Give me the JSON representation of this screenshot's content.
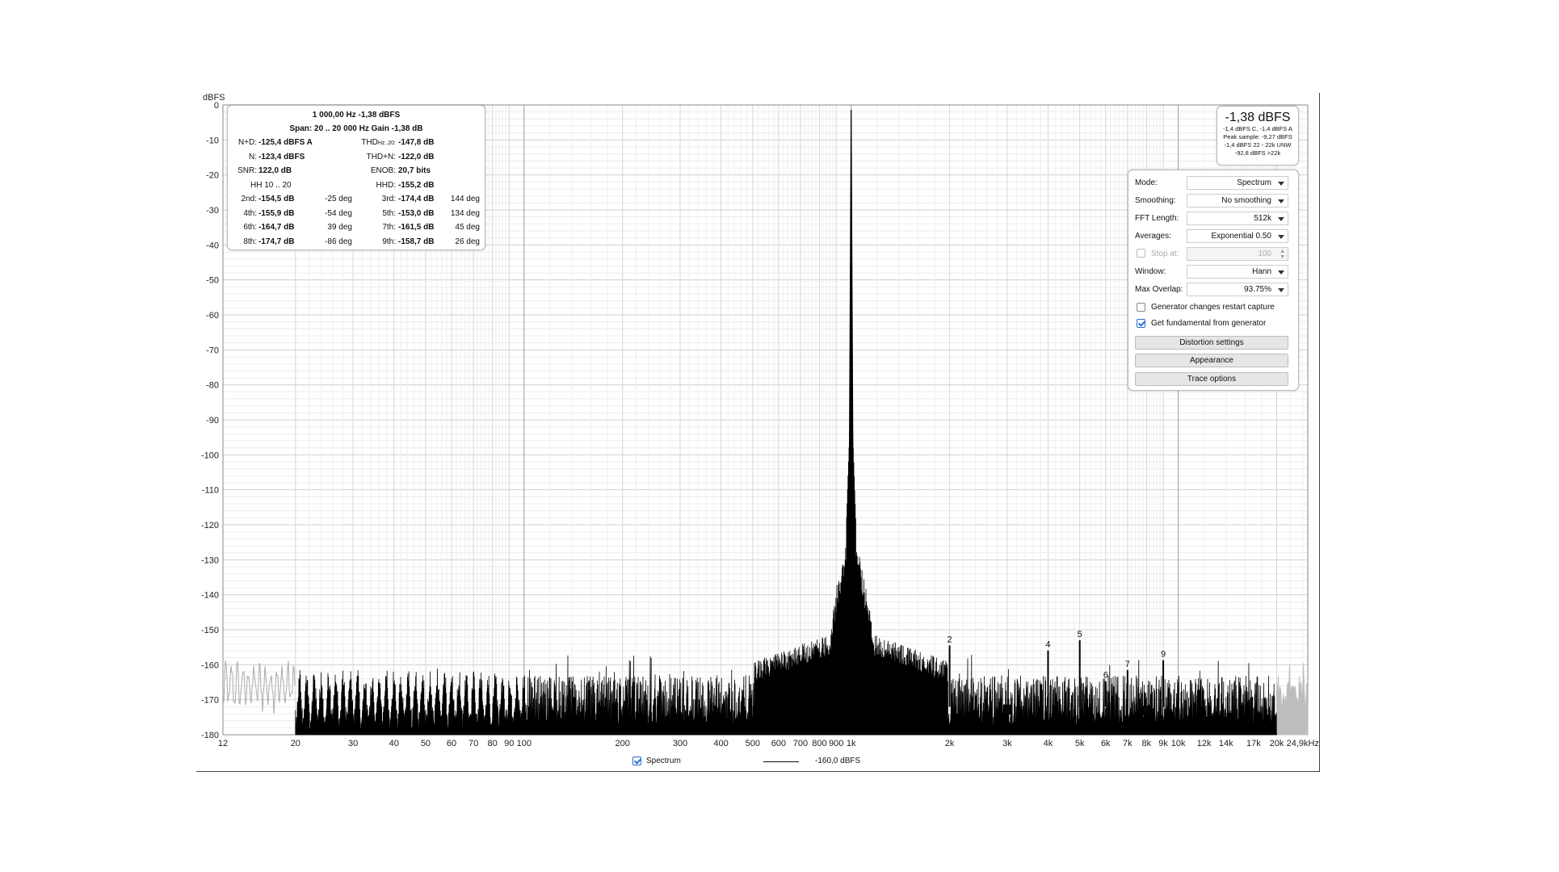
{
  "stats": {
    "header1": "1 000,00 Hz  -1,38 dBFS",
    "header2": "Span: 20 .. 20 000 Hz   Gain -1,38 dB",
    "rows": [
      {
        "l1": "N+D:",
        "v1": "-125,4 dBFS A",
        "d1": "",
        "l2": "THD",
        "v2": "-147,8 dB",
        "sub2": "Hz..20:",
        "d2": ""
      },
      {
        "l1": "N:",
        "v1": "-123,4 dBFS",
        "d1": "",
        "l2": "THD+N:",
        "v2": "-122,0 dB",
        "sub2": "",
        "d2": ""
      },
      {
        "l1": "SNR:",
        "v1": "122,0 dB",
        "d1": "",
        "l2": "ENOB:",
        "v2": "20,7 bits",
        "sub2": "",
        "d2": ""
      },
      {
        "l1": "HH 10 .. 20",
        "v1": "",
        "d1": "",
        "l2": "HHD:",
        "v2": "-155,2 dB",
        "sub2": "",
        "d2": ""
      },
      {
        "l1": "2nd:",
        "v1": "-154,5 dB",
        "d1": "-25 deg",
        "l2": "3rd:",
        "v2": "-174,4 dB",
        "sub2": "",
        "d2": "144 deg"
      },
      {
        "l1": "4th:",
        "v1": "-155,9 dB",
        "d1": "-54 deg",
        "l2": "5th:",
        "v2": "-153,0 dB",
        "sub2": "",
        "d2": "134 deg"
      },
      {
        "l1": "6th:",
        "v1": "-164,7 dB",
        "d1": "39 deg",
        "l2": "7th:",
        "v2": "-161,5 dB",
        "sub2": "",
        "d2": "45 deg"
      },
      {
        "l1": "8th:",
        "v1": "-174,7 dB",
        "d1": "-86 deg",
        "l2": "9th:",
        "v2": "-158,7 dB",
        "sub2": "",
        "d2": "26 deg"
      }
    ]
  },
  "level": {
    "main": "-1,38 dBFS",
    "lines": [
      "-1,4 dBFS C, -1,4 dBFS A",
      "Peak sample: -9,27 dBFS",
      "-1,4 dBFS 22 - 22k UNW",
      "-92,8 dBFS >22k"
    ]
  },
  "controls": {
    "mode": {
      "label": "Mode:",
      "value": "Spectrum"
    },
    "smoothing": {
      "label": "Smoothing:",
      "value": "No smoothing"
    },
    "fft": {
      "label": "FFT Length:",
      "value": "512k"
    },
    "averages": {
      "label": "Averages:",
      "value": "Exponential 0.50"
    },
    "stop": {
      "label": "Stop at:",
      "value": "100"
    },
    "window": {
      "label": "Window:",
      "value": "Hann"
    },
    "overlap": {
      "label": "Max Overlap:",
      "value": "93.75%"
    },
    "gen_restart": {
      "label": "Generator changes restart capture",
      "checked": false
    },
    "get_fund": {
      "label": "Get fundamental from generator",
      "checked": true
    },
    "btn_distortion": "Distortion settings",
    "btn_appearance": "Appearance",
    "btn_trace": "Trace options"
  },
  "legend": {
    "series_label": "Spectrum",
    "level_label": "-160,0 dBFS"
  },
  "chart_data": {
    "type": "line",
    "title": "",
    "ylabel": "dBFS",
    "xscale": "log",
    "xlim": [
      12,
      24900
    ],
    "ylim": [
      -180,
      0
    ],
    "yticks": [
      0,
      -10,
      -20,
      -30,
      -40,
      -50,
      -60,
      -70,
      -80,
      -90,
      -100,
      -110,
      -120,
      -130,
      -140,
      -150,
      -160,
      -170,
      -180
    ],
    "xticks": [
      {
        "v": 12,
        "t": "12"
      },
      {
        "v": 20,
        "t": "20"
      },
      {
        "v": 30,
        "t": "30"
      },
      {
        "v": 40,
        "t": "40"
      },
      {
        "v": 50,
        "t": "50"
      },
      {
        "v": 60,
        "t": "60"
      },
      {
        "v": 70,
        "t": "70"
      },
      {
        "v": 80,
        "t": "80"
      },
      {
        "v": 90,
        "t": "90"
      },
      {
        "v": 100,
        "t": "100"
      },
      {
        "v": 200,
        "t": "200"
      },
      {
        "v": 300,
        "t": "300"
      },
      {
        "v": 400,
        "t": "400"
      },
      {
        "v": 500,
        "t": "500"
      },
      {
        "v": 600,
        "t": "600"
      },
      {
        "v": 700,
        "t": "700"
      },
      {
        "v": 800,
        "t": "800"
      },
      {
        "v": 900,
        "t": "900"
      },
      {
        "v": 1000,
        "t": "1k"
      },
      {
        "v": 2000,
        "t": "2k"
      },
      {
        "v": 3000,
        "t": "3k"
      },
      {
        "v": 4000,
        "t": "4k"
      },
      {
        "v": 5000,
        "t": "5k"
      },
      {
        "v": 6000,
        "t": "6k"
      },
      {
        "v": 7000,
        "t": "7k"
      },
      {
        "v": 8000,
        "t": "8k"
      },
      {
        "v": 9000,
        "t": "9k"
      },
      {
        "v": 10000,
        "t": "10k"
      },
      {
        "v": 12000,
        "t": "12k"
      },
      {
        "v": 14000,
        "t": "14k"
      },
      {
        "v": 17000,
        "t": "17k"
      },
      {
        "v": 20000,
        "t": "20k"
      },
      {
        "v": 24900,
        "t": "24,9kHz"
      }
    ],
    "fundamental": {
      "x": 1000,
      "y": -1.38
    },
    "harmonics": [
      {
        "n": "2",
        "x": 2000,
        "y": -154.5
      },
      {
        "n": "3",
        "x": 3000,
        "y": -174.4
      },
      {
        "n": "4",
        "x": 4000,
        "y": -155.9
      },
      {
        "n": "5",
        "x": 5000,
        "y": -153.0
      },
      {
        "n": "6",
        "x": 6000,
        "y": -164.7
      },
      {
        "n": "7",
        "x": 7000,
        "y": -161.5
      },
      {
        "n": "8",
        "x": 8000,
        "y": -174.7
      },
      {
        "n": "9",
        "x": 9000,
        "y": -158.7
      }
    ],
    "noise_floor": -170,
    "analysis_band": [
      20,
      20000
    ],
    "series": [
      {
        "name": "Spectrum",
        "color": "#000000"
      }
    ],
    "grid": true
  }
}
